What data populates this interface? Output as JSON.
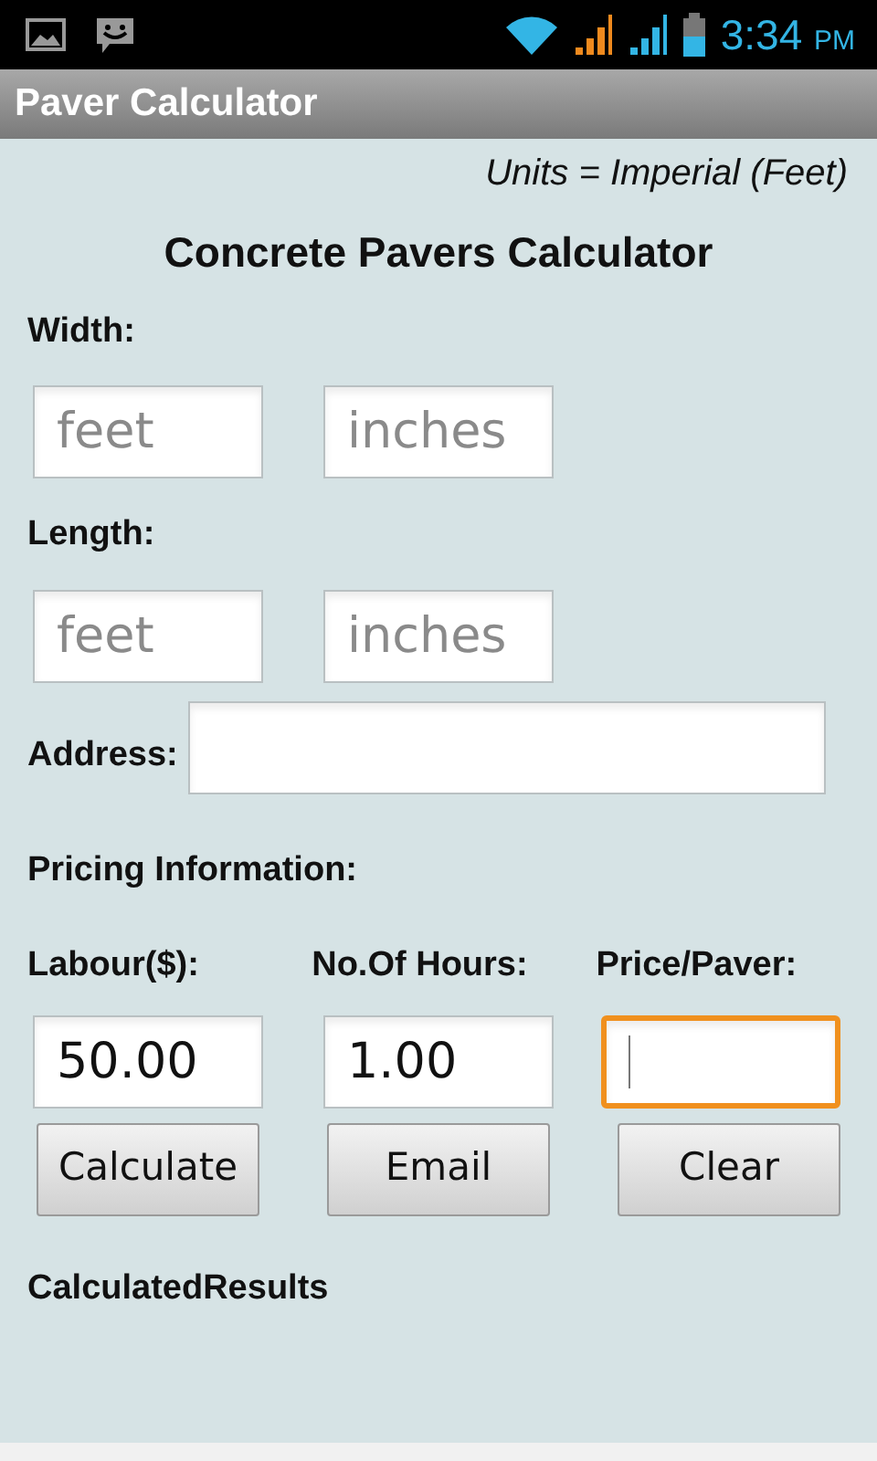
{
  "status_bar": {
    "time": "3:34",
    "meridiem": "PM"
  },
  "window": {
    "title": "Paver Calculator"
  },
  "units_note": "Units = Imperial (Feet)",
  "heading": "Concrete Pavers Calculator",
  "width": {
    "label": "Width:",
    "fields": [
      {
        "placeholder": "feet"
      },
      {
        "placeholder": "inches"
      }
    ]
  },
  "length": {
    "label": "Length:",
    "fields": [
      {
        "placeholder": "feet"
      },
      {
        "placeholder": "inches"
      }
    ]
  },
  "address": {
    "label": "Address:"
  },
  "pricing_label": "Pricing Information:",
  "pricing": [
    {
      "label": "Labour($):",
      "value": "50.00",
      "focused": false
    },
    {
      "label": "No.Of Hours:",
      "value": "1.00",
      "focused": false
    },
    {
      "label": "Price/Paver:",
      "focused": true
    }
  ],
  "buttons": [
    "Calculate",
    "Email",
    "Clear"
  ],
  "results_label": "CalculatedResults"
}
